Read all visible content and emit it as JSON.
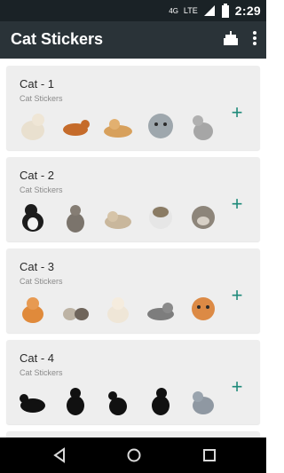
{
  "status_bar": {
    "time": "2:29",
    "network_label": "4G",
    "lte_label": "LTE"
  },
  "app_bar": {
    "title": "Cat Stickers",
    "actions": [
      "cake-icon",
      "more-vert-icon"
    ]
  },
  "packs": [
    {
      "title": "Cat - 1",
      "subtitle": "Cat Stickers",
      "add_label": "+",
      "stickers": [
        "white-cat-sitting",
        "orange-cat-walking",
        "orange-cat-lying",
        "grey-cat-face",
        "grey-cat-sitting"
      ]
    },
    {
      "title": "Cat - 2",
      "subtitle": "Cat Stickers",
      "add_label": "+",
      "stickers": [
        "tuxedo-cat",
        "tabby-cat-sitting",
        "cat-lying",
        "white-cat-face",
        "tabby-cat-face"
      ]
    },
    {
      "title": "Cat - 3",
      "subtitle": "Cat Stickers",
      "add_label": "+",
      "stickers": [
        "ginger-kitten",
        "kittens-pair",
        "white-kitten",
        "cat-lying-grey",
        "ginger-kitten-face"
      ]
    },
    {
      "title": "Cat - 4",
      "subtitle": "Cat Stickers",
      "add_label": "+",
      "stickers": [
        "black-cat-crouching",
        "black-cat-sitting",
        "black-cat-side",
        "black-cat-back",
        "blue-grey-cat"
      ]
    }
  ],
  "nav_bar": {
    "items": [
      "back-icon",
      "home-icon",
      "recents-icon"
    ]
  },
  "colors": {
    "status_bar": "#1a2226",
    "app_bar": "#2a3338",
    "card_bg": "#eeeeee",
    "accent": "#1e8a7a"
  }
}
